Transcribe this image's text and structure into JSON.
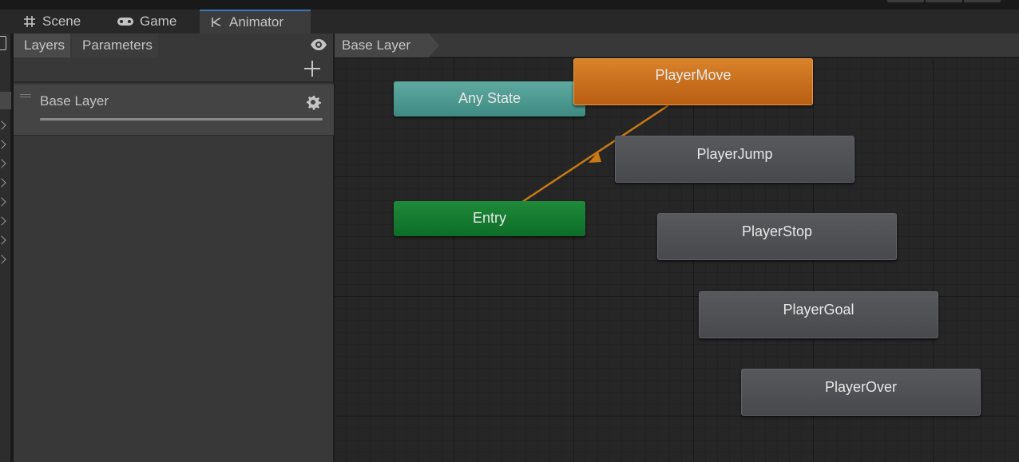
{
  "tabs": [
    {
      "label": "Scene",
      "icon": "grid-icon"
    },
    {
      "label": "Game",
      "icon": "gamepad-icon"
    },
    {
      "label": "Animator",
      "icon": "animator-icon"
    }
  ],
  "layers_panel": {
    "tabs": [
      "Layers",
      "Parameters"
    ],
    "layer": {
      "name": "Base Layer"
    }
  },
  "breadcrumb": "Base Layer",
  "graph": {
    "any_state": "Any State",
    "entry": "Entry",
    "default_state": "PlayerMove",
    "states": [
      "PlayerJump",
      "PlayerStop",
      "PlayerGoal",
      "PlayerOver"
    ]
  },
  "colors": {
    "default_state": "#c8701e",
    "any_state": "#4f9a92",
    "entry": "#177a31",
    "state": "#505155",
    "transition": "#c97a15",
    "active_tab_accent": "#3a79bb"
  }
}
